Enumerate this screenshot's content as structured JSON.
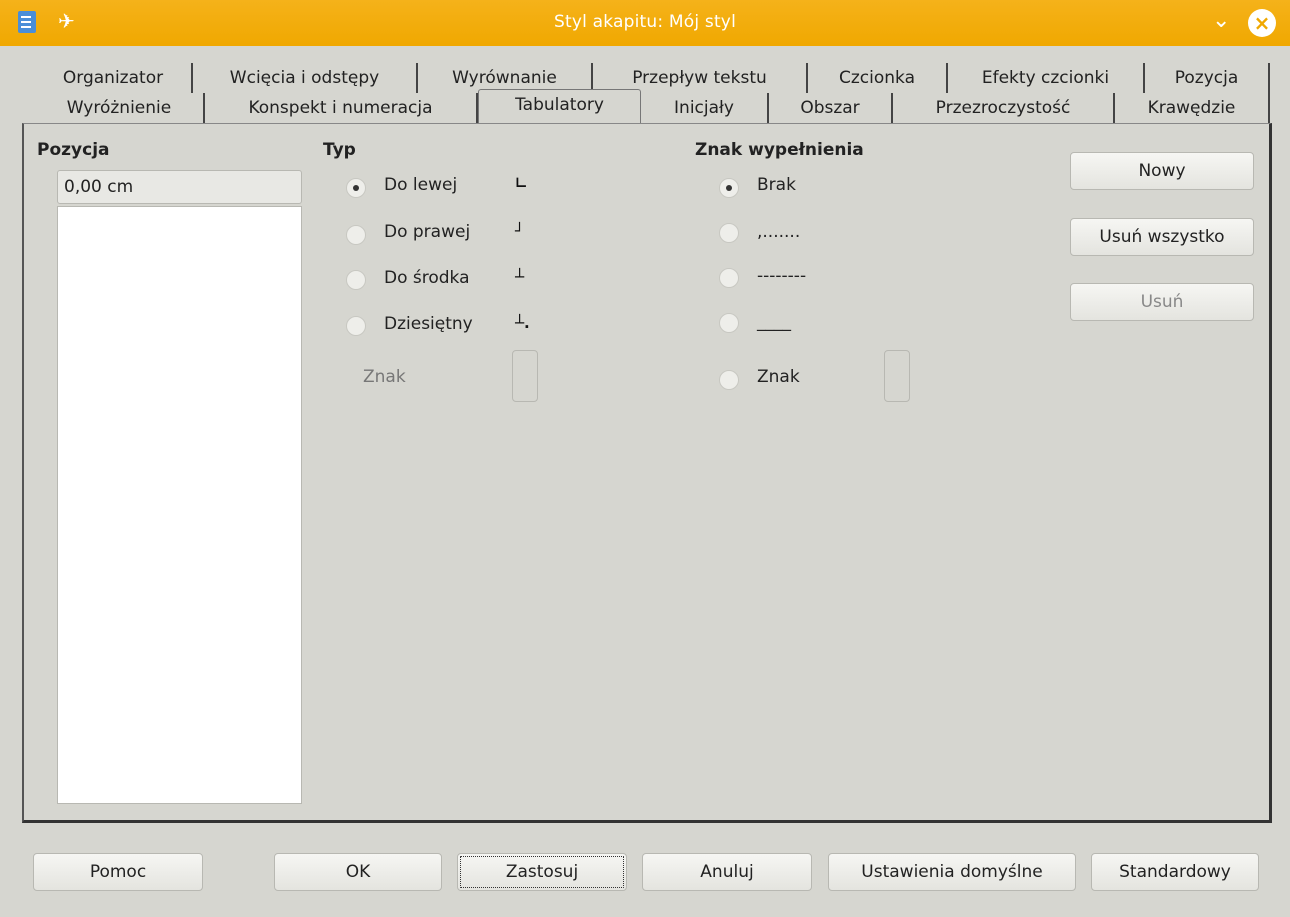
{
  "window": {
    "title": "Styl akapitu: Mój styl"
  },
  "tabs_row1": [
    {
      "label": "Organizator"
    },
    {
      "label": "Wcięcia i odstępy"
    },
    {
      "label": "Wyrównanie"
    },
    {
      "label": "Przepływ tekstu"
    },
    {
      "label": "Czcionka"
    },
    {
      "label": "Efekty czcionki"
    },
    {
      "label": "Pozycja"
    }
  ],
  "tabs_row2": [
    {
      "label": "Wyróżnienie"
    },
    {
      "label": "Konspekt i numeracja"
    },
    {
      "label": "Tabulatory"
    },
    {
      "label": "Inicjały"
    },
    {
      "label": "Obszar"
    },
    {
      "label": "Przezroczystość"
    },
    {
      "label": "Krawędzie"
    }
  ],
  "active_tab": "Tabulatory",
  "position": {
    "heading": "Pozycja",
    "value": "0,00 cm"
  },
  "type": {
    "heading": "Typ",
    "options": [
      {
        "label": "Do lewej",
        "checked": true,
        "mark": "∟"
      },
      {
        "label": "Do prawej",
        "checked": false,
        "mark": "┘"
      },
      {
        "label": "Do środka",
        "checked": false,
        "mark": "┴"
      },
      {
        "label": "Dziesiętny",
        "checked": false,
        "mark": "┴."
      }
    ],
    "char_label": "Znak"
  },
  "fill": {
    "heading": "Znak wypełnienia",
    "options": [
      {
        "label": "Brak",
        "checked": true
      },
      {
        "label": ",.......",
        "checked": false
      },
      {
        "label": "--------",
        "checked": false
      },
      {
        "label": "____",
        "checked": false
      },
      {
        "label": "Znak",
        "checked": false
      }
    ]
  },
  "side_buttons": {
    "new": "Nowy",
    "delete_all": "Usuń wszystko",
    "delete": "Usuń"
  },
  "bottom_buttons": {
    "help": "Pomoc",
    "ok": "OK",
    "apply": "Zastosuj",
    "cancel": "Anuluj",
    "defaults": "Ustawienia domyślne",
    "standard": "Standardowy"
  }
}
